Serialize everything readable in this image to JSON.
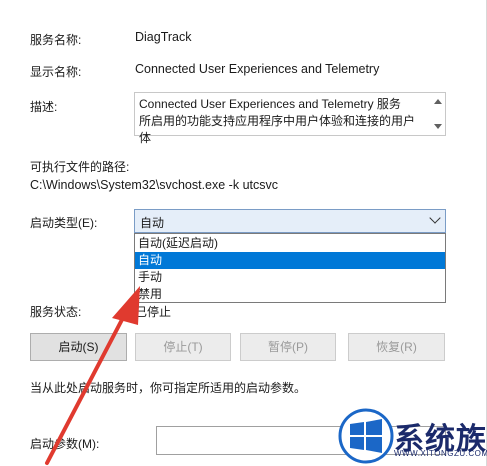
{
  "service": {
    "name_label": "服务名称:",
    "name_value": "DiagTrack",
    "display_label": "显示名称:",
    "display_value": "Connected User Experiences and Telemetry",
    "desc_label": "描述:",
    "desc_line1": "Connected User Experiences and Telemetry 服务",
    "desc_line2": "所启用的功能支持应用程序中用户体验和连接的用户体",
    "path_label": "可执行文件的路径:",
    "path_value": "C:\\Windows\\System32\\svchost.exe -k utcsvc"
  },
  "startup": {
    "label": "启动类型(E):",
    "selected": "自动",
    "options": [
      "自动(延迟启动)",
      "自动",
      "手动",
      "禁用"
    ],
    "highlighted_index": 1
  },
  "status": {
    "label": "服务状态:",
    "value": "已停止"
  },
  "buttons": {
    "start": "启动(S)",
    "stop": "停止(T)",
    "pause": "暂停(P)",
    "resume": "恢复(R)"
  },
  "hint": "当从此处启动服务时，你可指定所适用的启动参数。",
  "params": {
    "label": "启动参数(M):",
    "value": ""
  },
  "watermark": {
    "text": "系统族",
    "url": "WWW.XITONGZU.COM"
  },
  "colors": {
    "selection": "#0078d7",
    "arrow": "#e03a2f",
    "combo_bg": "#e5eef9"
  }
}
